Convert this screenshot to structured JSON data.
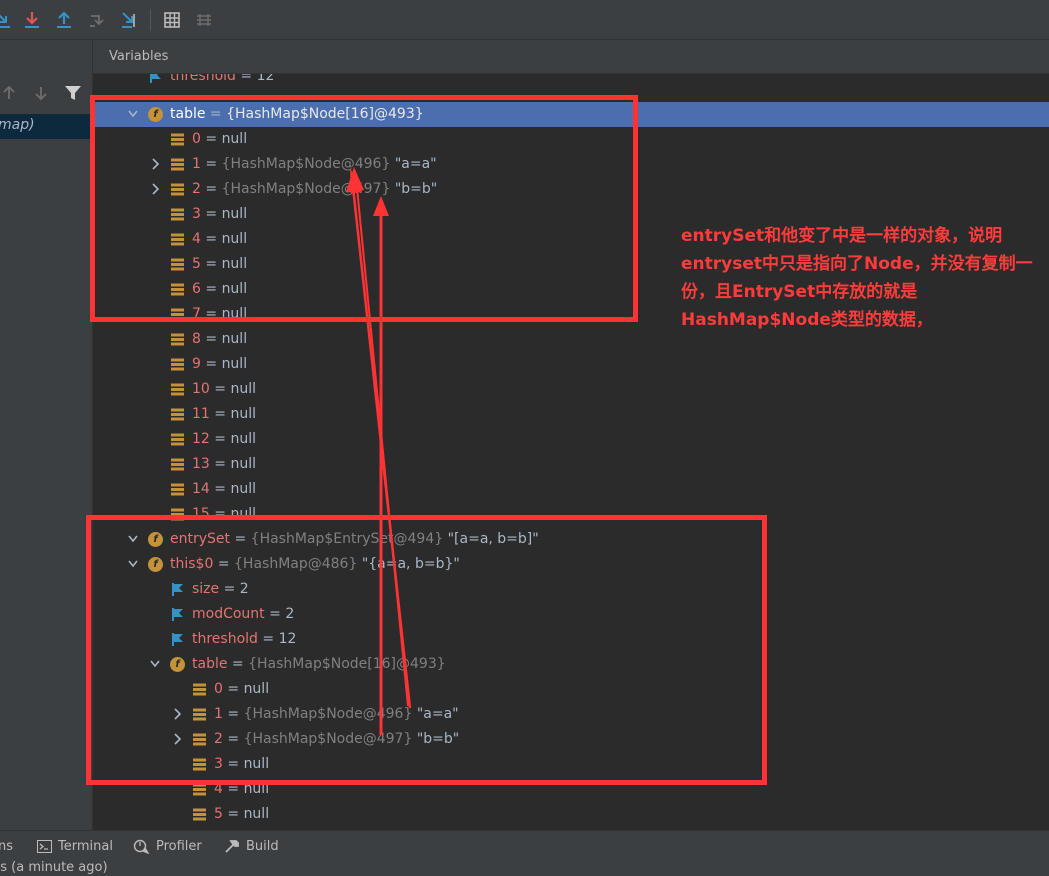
{
  "toolbar": {
    "icons": [
      "step-over-icon",
      "step-into-icon",
      "step-out-icon",
      "drop-frame-icon",
      "run-to-cursor-icon",
      "evaluate-icon",
      "trace-icon"
    ]
  },
  "left_panel": {
    "frame_label": "map)"
  },
  "variables_header": "Variables",
  "tree": [
    {
      "indent": 0,
      "chev": "",
      "icon": "flag",
      "name": "threshold",
      "eq": " = ",
      "type": "",
      "value": "12",
      "sel": false
    },
    {
      "indent": 0,
      "chev": "down",
      "icon": "field",
      "name": "table",
      "eq": " = ",
      "type": "{HashMap$Node[16]@493}",
      "value": "",
      "sel": true
    },
    {
      "indent": 1,
      "chev": "",
      "icon": "array",
      "name": "0",
      "eq": " = ",
      "type": "",
      "value": "null",
      "sel": false
    },
    {
      "indent": 1,
      "chev": "right",
      "icon": "array",
      "name": "1",
      "eq": " = ",
      "type": "{HashMap$Node@496}",
      "value": " \"a=a\"",
      "sel": false
    },
    {
      "indent": 1,
      "chev": "right",
      "icon": "array",
      "name": "2",
      "eq": " = ",
      "type": "{HashMap$Node@497}",
      "value": " \"b=b\"",
      "sel": false
    },
    {
      "indent": 1,
      "chev": "",
      "icon": "array",
      "name": "3",
      "eq": " = ",
      "type": "",
      "value": "null",
      "sel": false
    },
    {
      "indent": 1,
      "chev": "",
      "icon": "array",
      "name": "4",
      "eq": " = ",
      "type": "",
      "value": "null",
      "sel": false
    },
    {
      "indent": 1,
      "chev": "",
      "icon": "array",
      "name": "5",
      "eq": " = ",
      "type": "",
      "value": "null",
      "sel": false
    },
    {
      "indent": 1,
      "chev": "",
      "icon": "array",
      "name": "6",
      "eq": " = ",
      "type": "",
      "value": "null",
      "sel": false
    },
    {
      "indent": 1,
      "chev": "",
      "icon": "array",
      "name": "7",
      "eq": " = ",
      "type": "",
      "value": "null",
      "sel": false
    },
    {
      "indent": 1,
      "chev": "",
      "icon": "array",
      "name": "8",
      "eq": " = ",
      "type": "",
      "value": "null",
      "sel": false
    },
    {
      "indent": 1,
      "chev": "",
      "icon": "array",
      "name": "9",
      "eq": " = ",
      "type": "",
      "value": "null",
      "sel": false
    },
    {
      "indent": 1,
      "chev": "",
      "icon": "array",
      "name": "10",
      "eq": " = ",
      "type": "",
      "value": "null",
      "sel": false
    },
    {
      "indent": 1,
      "chev": "",
      "icon": "array",
      "name": "11",
      "eq": " = ",
      "type": "",
      "value": "null",
      "sel": false
    },
    {
      "indent": 1,
      "chev": "",
      "icon": "array",
      "name": "12",
      "eq": " = ",
      "type": "",
      "value": "null",
      "sel": false
    },
    {
      "indent": 1,
      "chev": "",
      "icon": "array",
      "name": "13",
      "eq": " = ",
      "type": "",
      "value": "null",
      "sel": false
    },
    {
      "indent": 1,
      "chev": "",
      "icon": "array",
      "name": "14",
      "eq": " = ",
      "type": "",
      "value": "null",
      "sel": false
    },
    {
      "indent": 1,
      "chev": "",
      "icon": "array",
      "name": "15",
      "eq": " = ",
      "type": "",
      "value": "null",
      "sel": false
    },
    {
      "indent": 0,
      "chev": "down",
      "icon": "field",
      "name": "entrySet",
      "eq": " = ",
      "type": "{HashMap$EntrySet@494}",
      "value": " \"[a=a, b=b]\"",
      "sel": false
    },
    {
      "indent": 1,
      "chev": "down",
      "icon": "field",
      "name": "this$0",
      "eq": " = ",
      "type": "{HashMap@486}",
      "value": " \"{a=a, b=b}\"",
      "sel": false
    },
    {
      "indent": 2,
      "chev": "",
      "icon": "flag",
      "name": "size",
      "eq": " = ",
      "type": "",
      "value": "2",
      "sel": false
    },
    {
      "indent": 2,
      "chev": "",
      "icon": "flag",
      "name": "modCount",
      "eq": " = ",
      "type": "",
      "value": "2",
      "sel": false
    },
    {
      "indent": 2,
      "chev": "",
      "icon": "flag",
      "name": "threshold",
      "eq": " = ",
      "type": "",
      "value": "12",
      "sel": false
    },
    {
      "indent": 2,
      "chev": "down",
      "icon": "field",
      "name": "table",
      "eq": " = ",
      "type": "{HashMap$Node[16]@493}",
      "value": "",
      "sel": false
    },
    {
      "indent": 3,
      "chev": "",
      "icon": "array",
      "name": "0",
      "eq": " = ",
      "type": "",
      "value": "null",
      "sel": false
    },
    {
      "indent": 3,
      "chev": "right",
      "icon": "array",
      "name": "1",
      "eq": " = ",
      "type": "{HashMap$Node@496}",
      "value": " \"a=a\"",
      "sel": false
    },
    {
      "indent": 3,
      "chev": "right",
      "icon": "array",
      "name": "2",
      "eq": " = ",
      "type": "{HashMap$Node@497}",
      "value": " \"b=b\"",
      "sel": false
    },
    {
      "indent": 3,
      "chev": "",
      "icon": "array",
      "name": "3",
      "eq": " = ",
      "type": "",
      "value": "null",
      "sel": false
    },
    {
      "indent": 3,
      "chev": "",
      "icon": "array",
      "name": "4",
      "eq": " = ",
      "type": "",
      "value": "null",
      "sel": false
    },
    {
      "indent": 3,
      "chev": "",
      "icon": "array",
      "name": "5",
      "eq": " = ",
      "type": "",
      "value": "null",
      "sel": false
    }
  ],
  "annotation": {
    "text": "entrySet和他变了中是一样的对象，说明entryset中只是指向了Node，并没有复制一份，且EntrySet中存放的就是HashMap$Node类型的数据，",
    "color": "#ff3b3b"
  },
  "bottom_tabs": [
    {
      "label": "ns",
      "icon": ""
    },
    {
      "label": "Terminal",
      "icon": "terminal-icon"
    },
    {
      "label": "Profiler",
      "icon": "profiler-icon"
    },
    {
      "label": "Build",
      "icon": "build-icon"
    }
  ],
  "status": "ns (a minute ago)",
  "colors": {
    "selection": "#4b6eaf",
    "highlight_box": "#ff3333",
    "name": "#e57373"
  }
}
